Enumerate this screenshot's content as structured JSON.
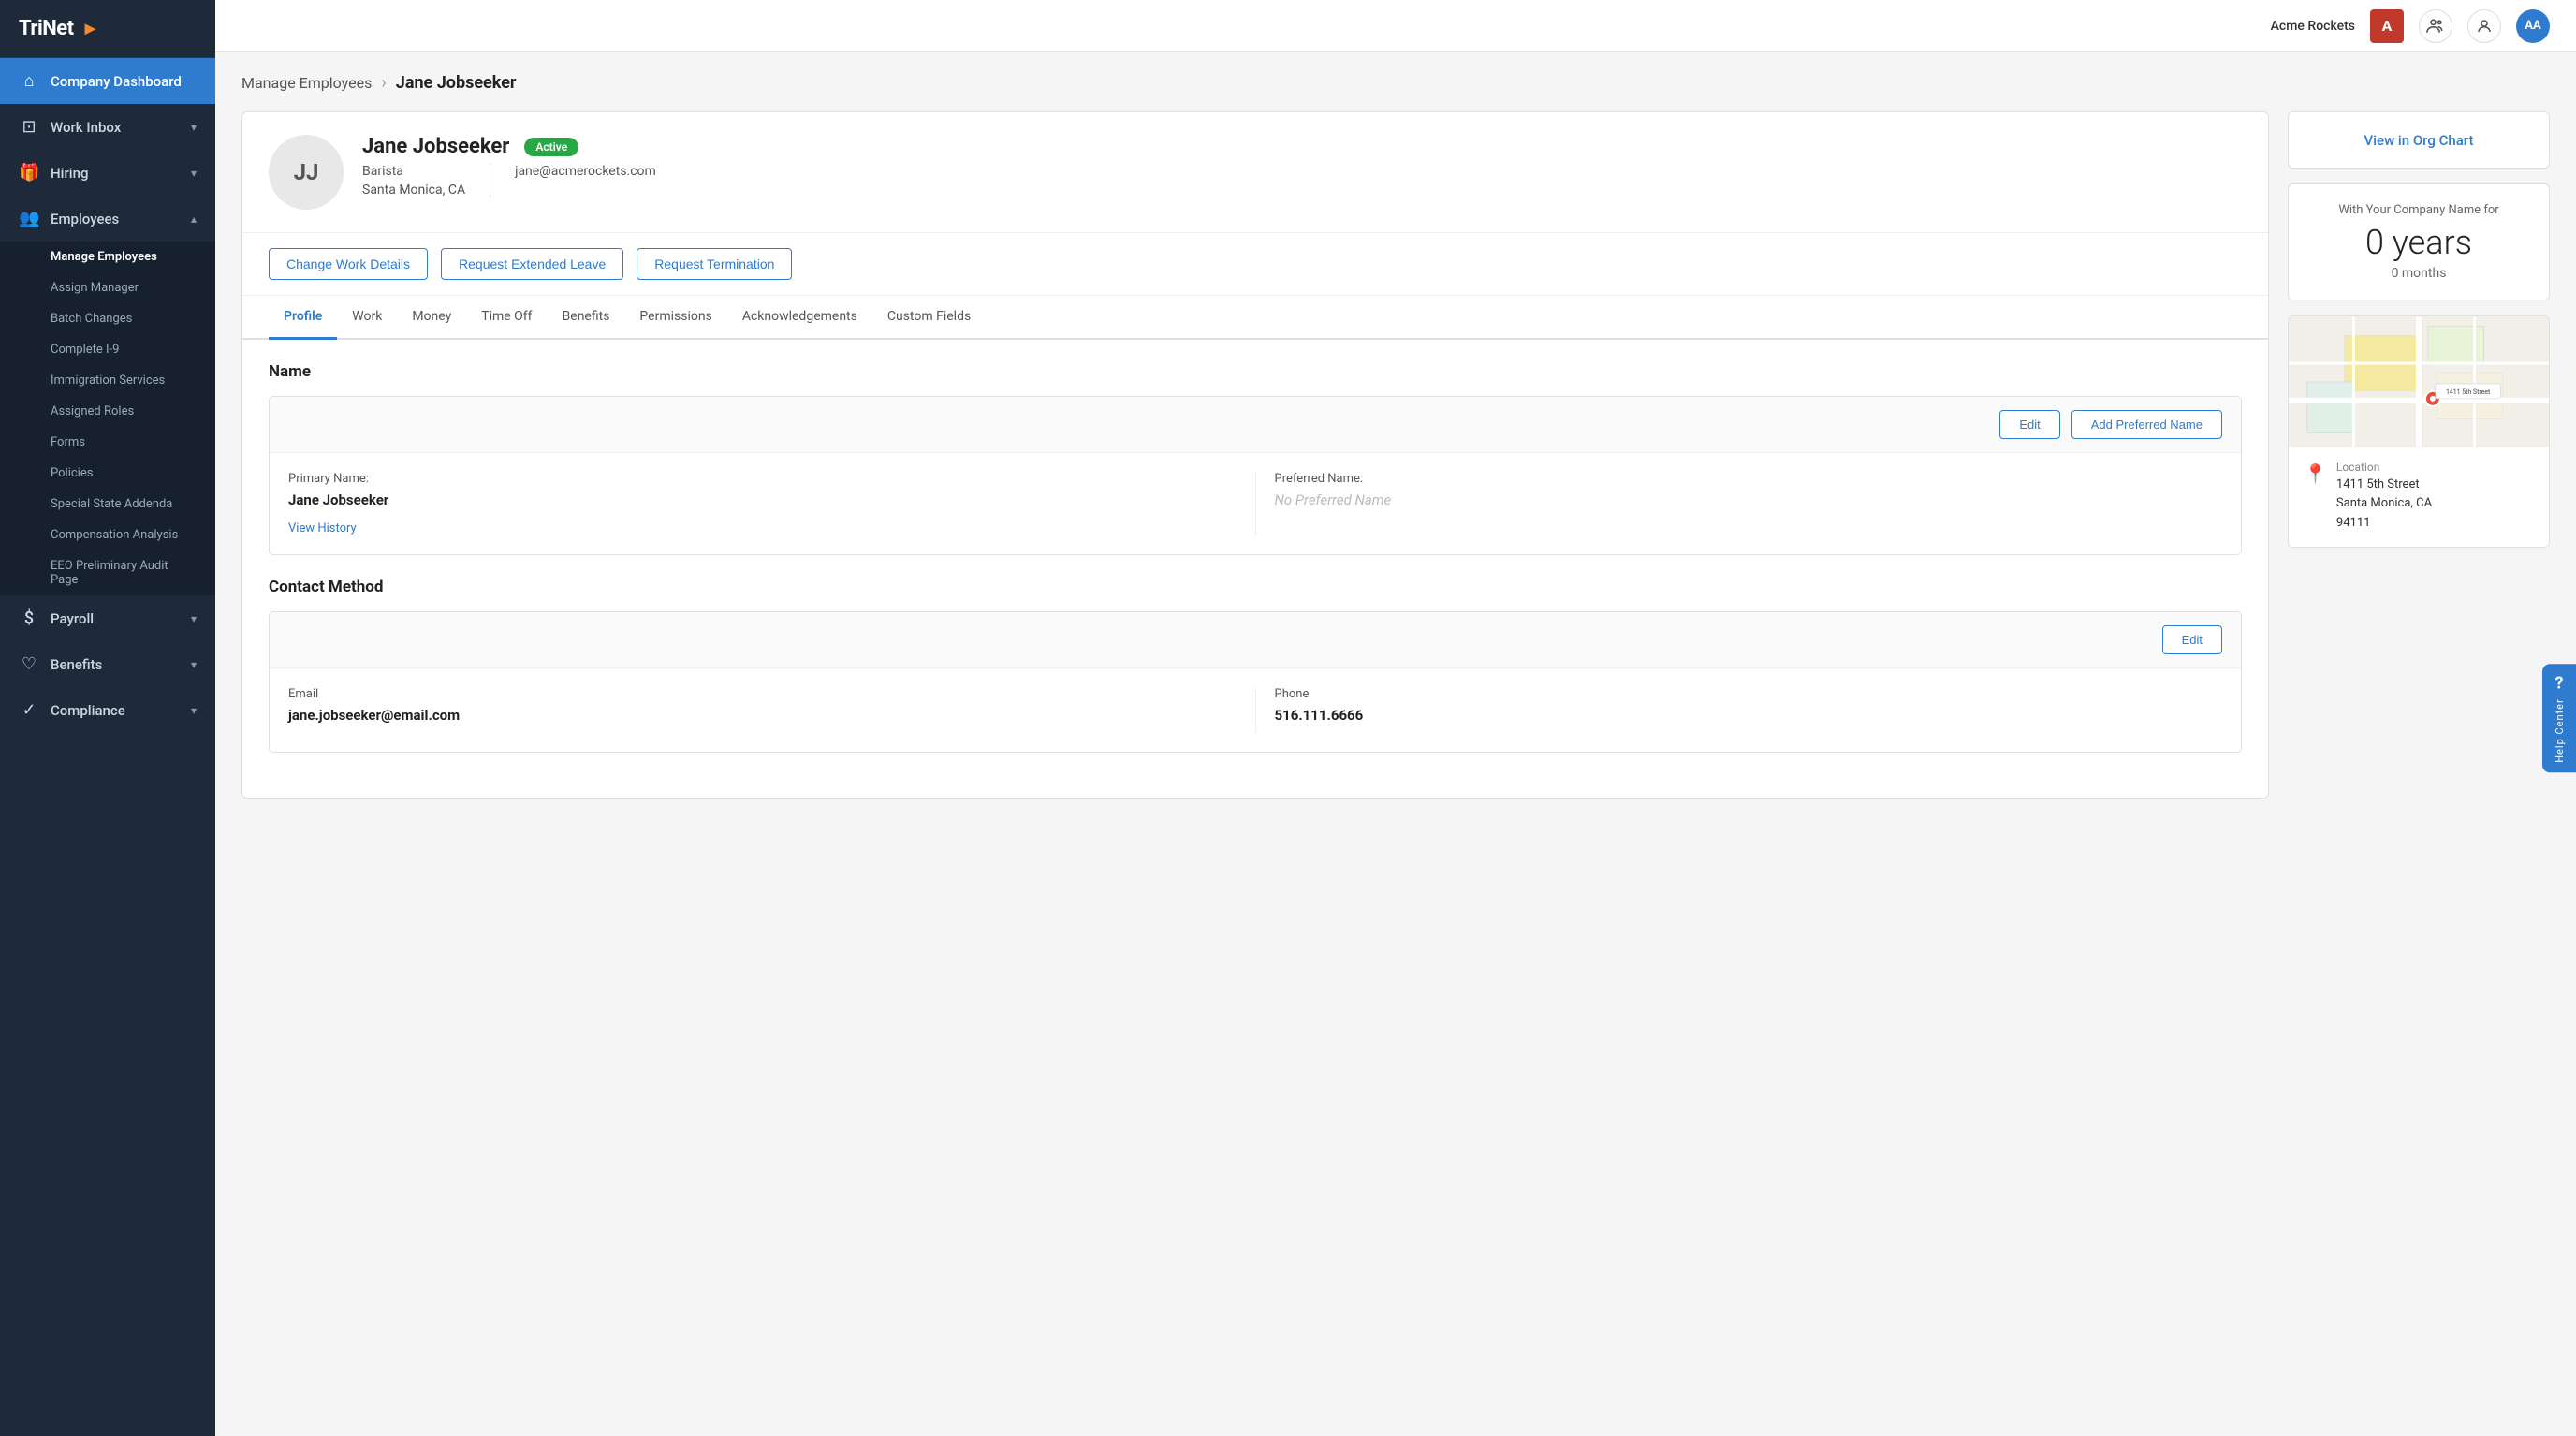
{
  "app": {
    "logo_text": "TriNet",
    "logo_arrow": "▶"
  },
  "topbar": {
    "company_name": "Acme Rockets",
    "company_badge": "A",
    "avatar": "AA"
  },
  "sidebar": {
    "nav_items": [
      {
        "id": "company-dashboard",
        "label": "Company Dashboard",
        "icon": "🏠",
        "active": true,
        "has_chevron": false
      },
      {
        "id": "work-inbox",
        "label": "Work Inbox",
        "icon": "📥",
        "active": false,
        "has_chevron": true
      },
      {
        "id": "hiring",
        "label": "Hiring",
        "icon": "🎁",
        "active": false,
        "has_chevron": true
      },
      {
        "id": "employees",
        "label": "Employees",
        "icon": "👥",
        "active": false,
        "has_chevron": true
      },
      {
        "id": "payroll",
        "label": "Payroll",
        "icon": "💲",
        "active": false,
        "has_chevron": true
      },
      {
        "id": "benefits",
        "label": "Benefits",
        "icon": "❤",
        "active": false,
        "has_chevron": true
      },
      {
        "id": "compliance",
        "label": "Compliance",
        "icon": "✓",
        "active": false,
        "has_chevron": true
      }
    ],
    "subnav_items": [
      {
        "id": "manage-employees",
        "label": "Manage Employees",
        "active": true
      },
      {
        "id": "assign-manager",
        "label": "Assign Manager",
        "active": false
      },
      {
        "id": "batch-changes",
        "label": "Batch Changes",
        "active": false
      },
      {
        "id": "complete-i9",
        "label": "Complete I-9",
        "active": false
      },
      {
        "id": "immigration-services",
        "label": "Immigration Services",
        "active": false
      },
      {
        "id": "assigned-roles",
        "label": "Assigned Roles",
        "active": false
      },
      {
        "id": "forms",
        "label": "Forms",
        "active": false
      },
      {
        "id": "policies",
        "label": "Policies",
        "active": false
      },
      {
        "id": "special-state-addenda",
        "label": "Special State Addenda",
        "active": false
      },
      {
        "id": "compensation-analysis",
        "label": "Compensation Analysis",
        "active": false
      },
      {
        "id": "eeo-audit",
        "label": "EEO Preliminary Audit Page",
        "active": false
      }
    ]
  },
  "breadcrumb": {
    "parent": "Manage Employees",
    "current": "Jane Jobseeker"
  },
  "employee": {
    "initials": "JJ",
    "name": "Jane Jobseeker",
    "title": "Barista",
    "location": "Santa Monica, CA",
    "email": "jane@acmerockets.com",
    "status": "Active"
  },
  "action_buttons": {
    "change_work": "Change Work Details",
    "extended_leave": "Request Extended Leave",
    "termination": "Request Termination"
  },
  "tabs": [
    {
      "id": "profile",
      "label": "Profile",
      "active": true
    },
    {
      "id": "work",
      "label": "Work",
      "active": false
    },
    {
      "id": "money",
      "label": "Money",
      "active": false
    },
    {
      "id": "time-off",
      "label": "Time Off",
      "active": false
    },
    {
      "id": "benefits",
      "label": "Benefits",
      "active": false
    },
    {
      "id": "permissions",
      "label": "Permissions",
      "active": false
    },
    {
      "id": "acknowledgements",
      "label": "Acknowledgements",
      "active": false
    },
    {
      "id": "custom-fields",
      "label": "Custom Fields",
      "active": false
    }
  ],
  "profile": {
    "name_section": {
      "title": "Name",
      "edit_label": "Edit",
      "add_preferred_label": "Add Preferred Name",
      "primary_name_label": "Primary Name:",
      "primary_name_value": "Jane Jobseeker",
      "preferred_name_label": "Preferred Name:",
      "preferred_name_placeholder": "No Preferred Name",
      "view_history_label": "View History"
    },
    "contact_section": {
      "title": "Contact Method",
      "edit_label": "Edit",
      "email_label": "Email",
      "email_value": "jane.jobseeker@email.com",
      "phone_label": "Phone",
      "phone_value": "516.111.6666"
    }
  },
  "right_panel": {
    "org_chart_link": "View in Org Chart",
    "tenure_label": "With Your Company Name for",
    "tenure_years": "0 years",
    "tenure_months": "0 months",
    "location_title": "Location",
    "location_address_line1": "1411 5th Street",
    "location_address_line2": "Santa Monica, CA",
    "location_address_line3": "94111"
  },
  "help": {
    "icon": "?",
    "label": "Help Center"
  }
}
